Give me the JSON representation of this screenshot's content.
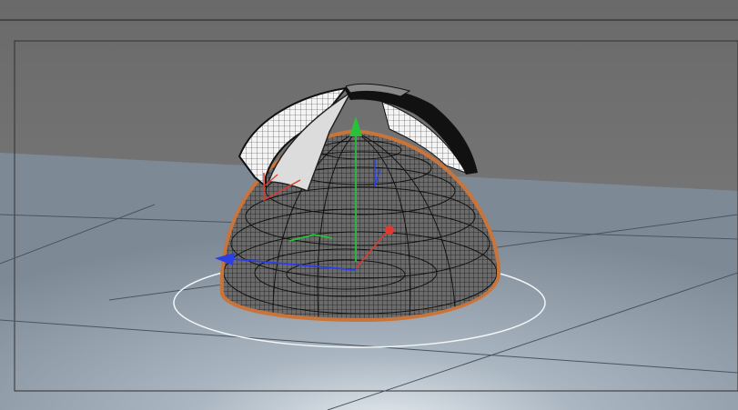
{
  "viewport": {
    "background_color": "#6f6f6f",
    "floor_color": "#8b98a4",
    "wire_color": "#111111",
    "selection_outline_color": "#c8743a",
    "axis_colors": {
      "x": "#e03a2f",
      "y": "#27c23a",
      "z": "#2a3fe6"
    }
  },
  "icons": [
    "move-gizmo-icon",
    "world-axis-icon",
    "light-axis-icon"
  ]
}
